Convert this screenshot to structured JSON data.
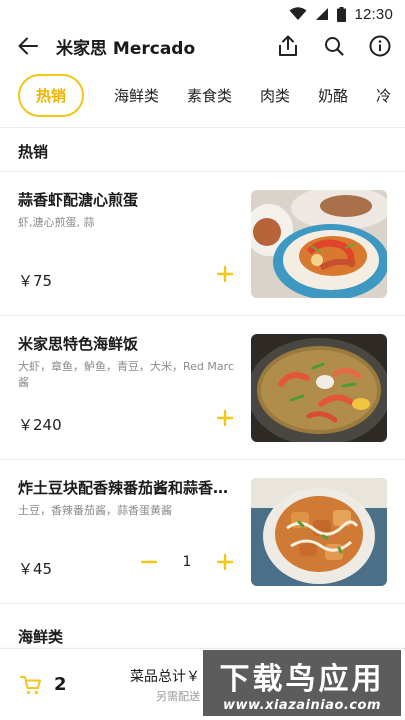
{
  "status_bar": {
    "time": "12:30"
  },
  "app_bar": {
    "title": "米家思 Mercado"
  },
  "tabs": [
    {
      "label": "热销",
      "active": true
    },
    {
      "label": "海鲜类"
    },
    {
      "label": "素食类"
    },
    {
      "label": "肉类"
    },
    {
      "label": "奶酪"
    },
    {
      "label": "冷"
    }
  ],
  "sections": {
    "hot": "热销",
    "seafood": "海鲜类"
  },
  "dishes": [
    {
      "name": "蒜香虾配溏心煎蛋",
      "desc": "虾,溏心煎蛋, 蒜",
      "price": "￥75"
    },
    {
      "name": "米家思特色海鲜饭",
      "desc": "大虾，章鱼，鲈鱼，青豆，大米，Red Marc酱",
      "price": "￥240"
    },
    {
      "name": "炸土豆块配香辣番茄酱和蒜香…",
      "desc": "土豆，香辣番茄酱，蒜香蛋黄酱",
      "price": "￥45",
      "quantity": "1"
    }
  ],
  "bottom_bar": {
    "cart_count": "2",
    "total_label": "菜品总计￥",
    "delivery_label": "另需配送"
  },
  "watermark": {
    "title": "下载鸟应用",
    "url": "www.xiazainiao.com"
  },
  "colors": {
    "accent": "#f5c518",
    "accent_text": "#f0b400"
  }
}
